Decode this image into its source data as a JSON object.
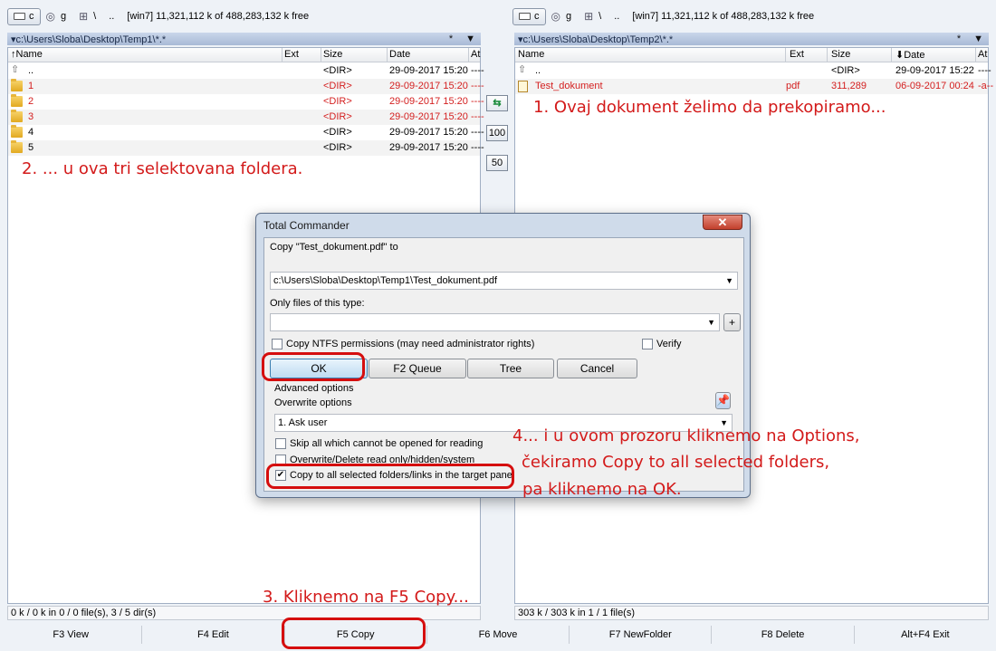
{
  "left": {
    "drive": "c",
    "drive2": "g",
    "nav": [
      "\\",
      ".."
    ],
    "drive_info": "[win7]  11,321,112 k of 488,283,132 k free",
    "path": "▾c:\\Users\\Sloba\\Desktop\\Temp1\\*.*",
    "path_right": [
      "*",
      "▼"
    ],
    "columns": [
      "↑Name",
      "Ext",
      "Size",
      "Date",
      "At"
    ],
    "rows": [
      {
        "name": "..",
        "ext": "",
        "size": "<DIR>",
        "date": "29-09-2017 15:20",
        "attr": "----",
        "selected": false,
        "icon": "up-icon"
      },
      {
        "name": "1",
        "ext": "",
        "size": "<DIR>",
        "date": "29-09-2017 15:20",
        "attr": "----",
        "selected": true,
        "icon": "folder-icon"
      },
      {
        "name": "2",
        "ext": "",
        "size": "<DIR>",
        "date": "29-09-2017 15:20",
        "attr": "----",
        "selected": true,
        "icon": "folder-icon"
      },
      {
        "name": "3",
        "ext": "",
        "size": "<DIR>",
        "date": "29-09-2017 15:20",
        "attr": "----",
        "selected": true,
        "icon": "folder-icon"
      },
      {
        "name": "4",
        "ext": "",
        "size": "<DIR>",
        "date": "29-09-2017 15:20",
        "attr": "----",
        "selected": false,
        "icon": "folder-icon"
      },
      {
        "name": "5",
        "ext": "",
        "size": "<DIR>",
        "date": "29-09-2017 15:20",
        "attr": "----",
        "selected": false,
        "icon": "folder-icon"
      }
    ],
    "status": "0 k / 0 k in 0 / 0 file(s), 3 / 5 dir(s)"
  },
  "right": {
    "drive": "c",
    "drive2": "g",
    "nav": [
      "\\",
      ".."
    ],
    "drive_info": "[win7]  11,321,112 k of 488,283,132 k free",
    "path": "▾c:\\Users\\Sloba\\Desktop\\Temp2\\*.*",
    "path_right": [
      "*",
      "▼"
    ],
    "columns": [
      "Name",
      "Ext",
      "Size",
      "⬇Date",
      "At"
    ],
    "rows": [
      {
        "name": "..",
        "ext": "",
        "size": "<DIR>",
        "date": "29-09-2017 15:22",
        "attr": "----",
        "selected": false,
        "icon": "up-icon"
      },
      {
        "name": "Test_dokument",
        "ext": "pdf",
        "size": "311,289",
        "date": "06-09-2017 00:24",
        "attr": "-a--",
        "selected": true,
        "icon": "pdf-icon"
      }
    ],
    "status": "303 k / 303 k in 1 / 1 file(s)"
  },
  "middle_buttons": [
    "100",
    "50"
  ],
  "dialog": {
    "title": "Total Commander",
    "close": "✕",
    "copy_label": "Copy \"Test_dokument.pdf\" to",
    "target_path": "c:\\Users\\Sloba\\Desktop\\Temp1\\Test_dokument.pdf",
    "filter_label": "Only files of this type:",
    "filter_value": "",
    "plus": "+",
    "ntfs_label": "Copy NTFS permissions (may need administrator rights)",
    "verify_label": "Verify",
    "buttons": {
      "ok": "OK",
      "queue": "F2 Queue",
      "tree": "Tree",
      "cancel": "Cancel"
    },
    "advanced_label": "Advanced options",
    "overwrite_label": "Overwrite options",
    "overwrite_value": "1. Ask user",
    "skip_label": "Skip all which cannot be opened for reading",
    "overwrite_ro_label": "Overwrite/Delete read only/hidden/system",
    "copy_all_label": "Copy to all selected folders/links in the target panel",
    "copy_all_checked": "✔"
  },
  "fkeys": [
    "F3 View",
    "F4 Edit",
    "F5 Copy",
    "F6 Move",
    "F7 NewFolder",
    "F8 Delete",
    "Alt+F4 Exit"
  ],
  "annotations": {
    "a1": "1. Ovaj dokument želimo da prekopiramo...",
    "a2": "2. ... u ova tri selektovana foldera.",
    "a3": "3. Kliknemo na F5 Copy...",
    "a4_line1": "4... i u ovom prozoru kliknemo na Options,",
    "a4_line2": "čekiramo Copy to all selected folders,",
    "a4_line3": "pa kliknemo na OK."
  },
  "colors": {
    "selected_text": "#d42020",
    "annotation": "#d31a1a",
    "highlight_box": "#d50e0e"
  }
}
